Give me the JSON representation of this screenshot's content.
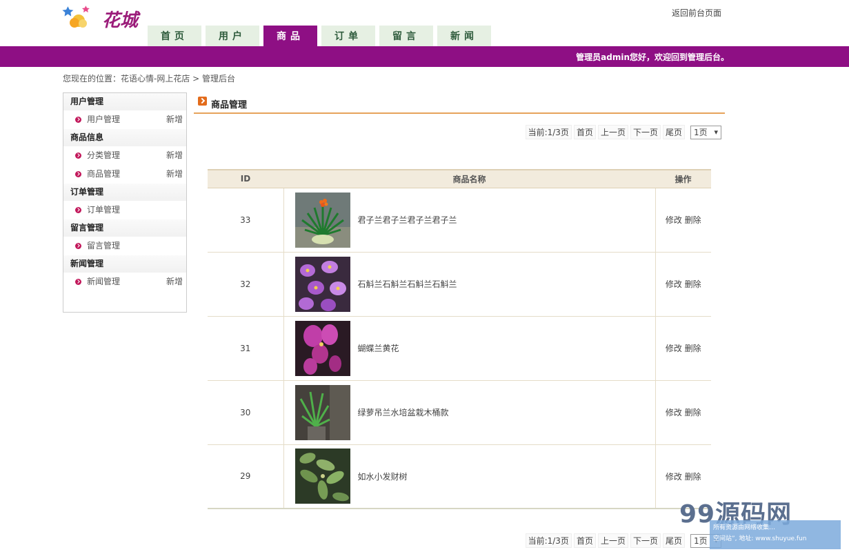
{
  "header": {
    "logo_text": "花城",
    "back_link": "返回前台页面",
    "nav": [
      "首页",
      "用户",
      "商品",
      "订单",
      "留言",
      "新闻"
    ],
    "active_nav_index": 2,
    "welcome": "管理员admin您好，欢迎回到管理后台。",
    "brand_color": "#8e0f84"
  },
  "breadcrumb": {
    "prefix": "您现在的位置：",
    "site": "花语心情-网上花店",
    "sep": " > ",
    "current": "管理后台"
  },
  "sidebar": {
    "groups": [
      {
        "title": "用户管理",
        "items": [
          {
            "label": "用户管理",
            "add": "新增"
          }
        ]
      },
      {
        "title": "商品信息",
        "items": [
          {
            "label": "分类管理",
            "add": "新增"
          },
          {
            "label": "商品管理",
            "add": "新增"
          }
        ]
      },
      {
        "title": "订单管理",
        "items": [
          {
            "label": "订单管理",
            "add": ""
          }
        ]
      },
      {
        "title": "留言管理",
        "items": [
          {
            "label": "留言管理",
            "add": ""
          }
        ]
      },
      {
        "title": "新闻管理",
        "items": [
          {
            "label": "新闻管理",
            "add": "新增"
          }
        ]
      }
    ]
  },
  "main": {
    "title": "商品管理",
    "pager": {
      "current": "当前:1/3页",
      "first": "首页",
      "prev": "上一页",
      "next": "下一页",
      "last": "尾页",
      "select_value": "1页"
    },
    "table": {
      "headers": [
        "ID",
        "商品名称",
        "操作"
      ],
      "rows": [
        {
          "id": "33",
          "name": "君子兰君子兰君子兰君子兰",
          "edit": "修改",
          "del": "删除",
          "image_icon": "clivia-flower-image"
        },
        {
          "id": "32",
          "name": "石斛兰石斛兰石斛兰石斛兰",
          "edit": "修改",
          "del": "删除",
          "image_icon": "orchid-flower-image"
        },
        {
          "id": "31",
          "name": "蝴蝶兰黄花",
          "edit": "修改",
          "del": "删除",
          "image_icon": "phalaenopsis-flower-image"
        },
        {
          "id": "30",
          "name": "绿萝吊兰水培盆栽木桶款",
          "edit": "修改",
          "del": "删除",
          "image_icon": "spider-plant-image"
        },
        {
          "id": "29",
          "name": "如水小发财树",
          "edit": "修改",
          "del": "删除",
          "image_icon": "money-tree-image"
        }
      ]
    }
  },
  "watermark": {
    "logo": "99源码网",
    "line1": "所有资源由网络收集…",
    "line2": "空间站”, 地址: www.shuyue.fun"
  }
}
